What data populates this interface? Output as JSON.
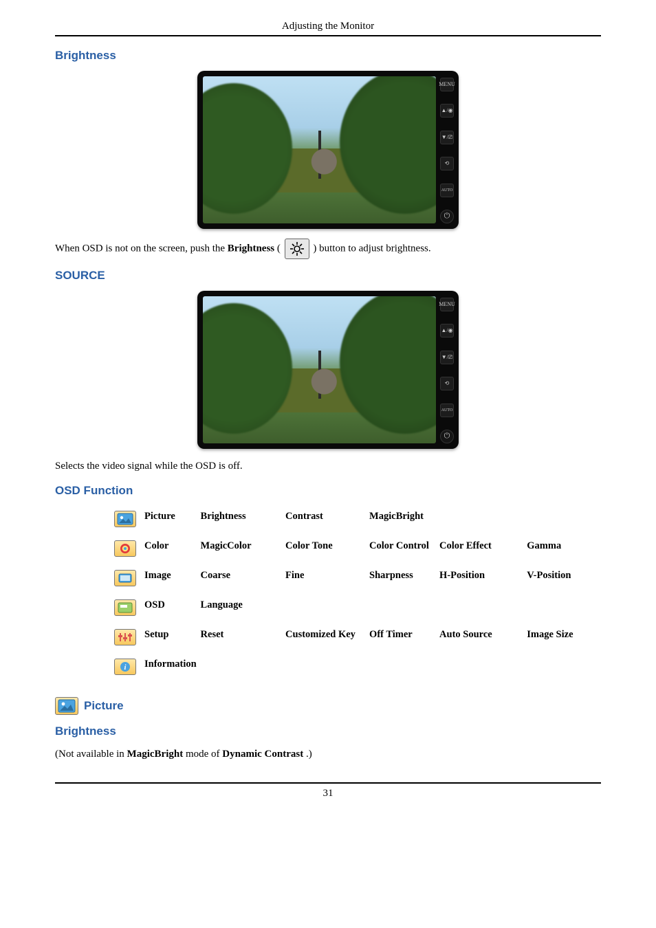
{
  "running_header": "Adjusting the Monitor",
  "sections": {
    "brightness_top": "Brightness",
    "source": "SOURCE",
    "osd_function": "OSD Function",
    "picture": "Picture",
    "brightness_bottom": "Brightness"
  },
  "brightness_sentence": {
    "part1": "When OSD is not on the screen, push the ",
    "bold": "Brightness",
    "part2": " (",
    "part3": ") button to adjust brightness."
  },
  "source_sentence": "Selects the video signal while the OSD is off.",
  "osd_rows": [
    {
      "label": "Picture",
      "c1": "Brightness",
      "c2": "Contrast",
      "c3": "MagicBright",
      "c4": "",
      "c5": ""
    },
    {
      "label": "Color",
      "c1": "MagicColor",
      "c2": "Color Tone",
      "c3": "Color Control",
      "c4": "Color Effect",
      "c5": "Gamma"
    },
    {
      "label": "Image",
      "c1": "Coarse",
      "c2": "Fine",
      "c3": "Sharpness",
      "c4": "H-Position",
      "c5": "V-Position"
    },
    {
      "label": "OSD",
      "c1": "Language",
      "c2": "",
      "c3": "",
      "c4": "",
      "c5": ""
    },
    {
      "label": "Setup",
      "c1": "Reset",
      "c2": "Customized Key",
      "c3": "Off Timer",
      "c4": "Auto Source",
      "c5": "Image Size"
    },
    {
      "label": "Information",
      "c1": "",
      "c2": "",
      "c3": "",
      "c4": "",
      "c5": ""
    }
  ],
  "brightness_note": {
    "part1": "(Not available in ",
    "b1": "MagicBright",
    "part2": "  mode of ",
    "b2": "Dynamic Contrast",
    "part3": ".)"
  },
  "monitor_buttons": [
    "MENU",
    "▲/◉",
    "▼/⎚",
    "⟲",
    "AUTO"
  ],
  "page_number": "31"
}
